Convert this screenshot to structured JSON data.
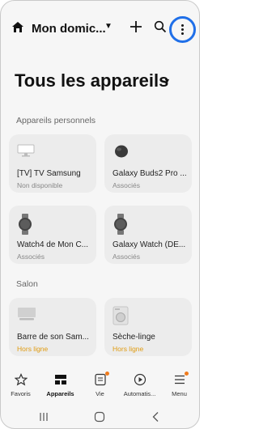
{
  "header": {
    "home_name": "Mon domic..."
  },
  "page": {
    "title": "Tous les appareils"
  },
  "sections": [
    {
      "label": "Appareils personnels"
    },
    {
      "label": "Salon"
    }
  ],
  "devices": [
    {
      "name": "[TV] TV Samsung",
      "status": "Non disponible",
      "icon": "tv-icon"
    },
    {
      "name": "Galaxy Buds2 Pro ...",
      "status": "Associés",
      "icon": "earbuds-icon"
    },
    {
      "name": "Watch4 de Mon C...",
      "status": "Associés",
      "icon": "watch-icon"
    },
    {
      "name": "Galaxy Watch (DE...",
      "status": "Associés",
      "icon": "watch-icon"
    },
    {
      "name": "Barre de son Sam...",
      "status": "Hors ligne",
      "icon": "soundbar-icon"
    },
    {
      "name": "Sèche-linge",
      "status": "Hors ligne",
      "icon": "dryer-icon"
    }
  ],
  "nav": [
    {
      "label": "Favoris",
      "icon": "star-icon"
    },
    {
      "label": "Appareils",
      "icon": "devices-grid-icon"
    },
    {
      "label": "Vie",
      "icon": "life-icon"
    },
    {
      "label": "Automatis...",
      "icon": "play-icon"
    },
    {
      "label": "Menu",
      "icon": "menu-icon"
    }
  ],
  "colors": {
    "accent": "#1f6fe8",
    "offline": "#e09b10",
    "notification": "#f07c1e"
  }
}
